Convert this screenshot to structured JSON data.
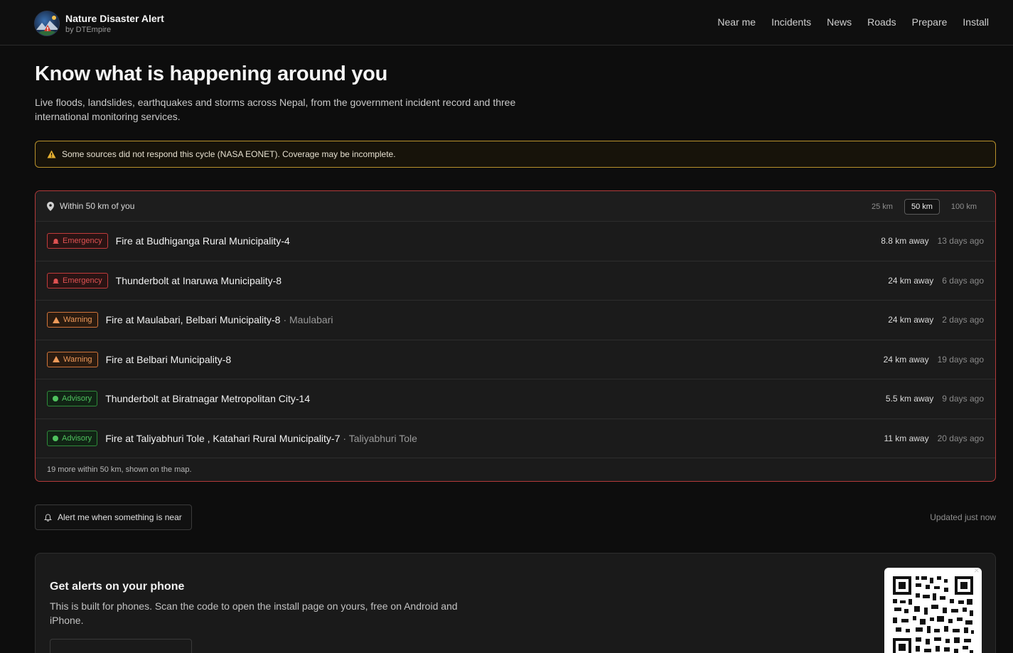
{
  "brand": {
    "title": "Nature Disaster Alert",
    "subtitle": "by DTEmpire"
  },
  "nav": [
    "Near me",
    "Incidents",
    "News",
    "Roads",
    "Prepare",
    "Install"
  ],
  "hero": {
    "title": "Know what is happening around you",
    "subtitle": "Live floods, landslides, earthquakes and storms across Nepal, from the government incident record and three international monitoring services."
  },
  "banner": {
    "text": "Some sources did not respond this cycle (NASA EONET). Coverage may be incomplete."
  },
  "panel": {
    "heading": "Within 50 km of you",
    "radius_options": [
      "25 km",
      "50 km",
      "100 km"
    ],
    "selected_radius": "50 km",
    "incidents": [
      {
        "level": "Emergency",
        "title": "Fire at Budhiganga Rural Municipality-4",
        "place": "",
        "distance": "8.8 km away",
        "ago": "13 days ago"
      },
      {
        "level": "Emergency",
        "title": "Thunderbolt at Inaruwa Municipality-8",
        "place": "",
        "distance": "24 km away",
        "ago": "6 days ago"
      },
      {
        "level": "Warning",
        "title": "Fire at Maulabari, Belbari Municipality-8",
        "place": "· Maulabari",
        "distance": "24 km away",
        "ago": "2 days ago"
      },
      {
        "level": "Warning",
        "title": "Fire at Belbari Municipality-8",
        "place": "",
        "distance": "24 km away",
        "ago": "19 days ago"
      },
      {
        "level": "Advisory",
        "title": "Thunderbolt at Biratnagar Metropolitan City-14",
        "place": "",
        "distance": "5.5 km away",
        "ago": "9 days ago"
      },
      {
        "level": "Advisory",
        "title": "Fire at Taliyabhuri Tole , Katahari Rural Municipality-7",
        "place": "· Taliyabhuri Tole",
        "distance": "11 km away",
        "ago": "20 days ago"
      }
    ],
    "footer": "19 more within 50 km, shown on the map."
  },
  "alert_button": {
    "label": "Alert me when something is near"
  },
  "updated": "Updated just now",
  "phone": {
    "title": "Get alerts on your phone",
    "description": "This is built for phones. Scan the code to open the install page on yours, free on Android and iPhone.",
    "close_glyph": "×"
  },
  "colors": {
    "emergency": "#e05252",
    "warning": "#ef9a5a",
    "advisory": "#4fc25e",
    "banner_border": "#b8912c",
    "panel_border": "#b33a3a"
  }
}
